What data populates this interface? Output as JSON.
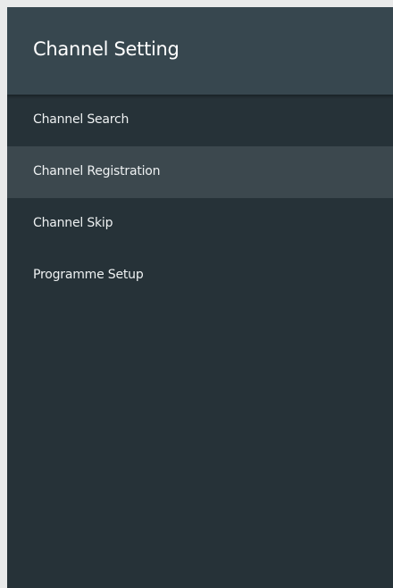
{
  "header": {
    "title": "Channel Setting"
  },
  "menu": {
    "items": [
      {
        "label": "Channel Search",
        "selected": false
      },
      {
        "label": "Channel Registration",
        "selected": true
      },
      {
        "label": "Channel Skip",
        "selected": false
      },
      {
        "label": "Programme Setup",
        "selected": false
      }
    ]
  },
  "colors": {
    "panel_background": "#263238",
    "header_background": "#37474f",
    "selected_item_background": "#3c484e",
    "text": "#ffffff"
  }
}
